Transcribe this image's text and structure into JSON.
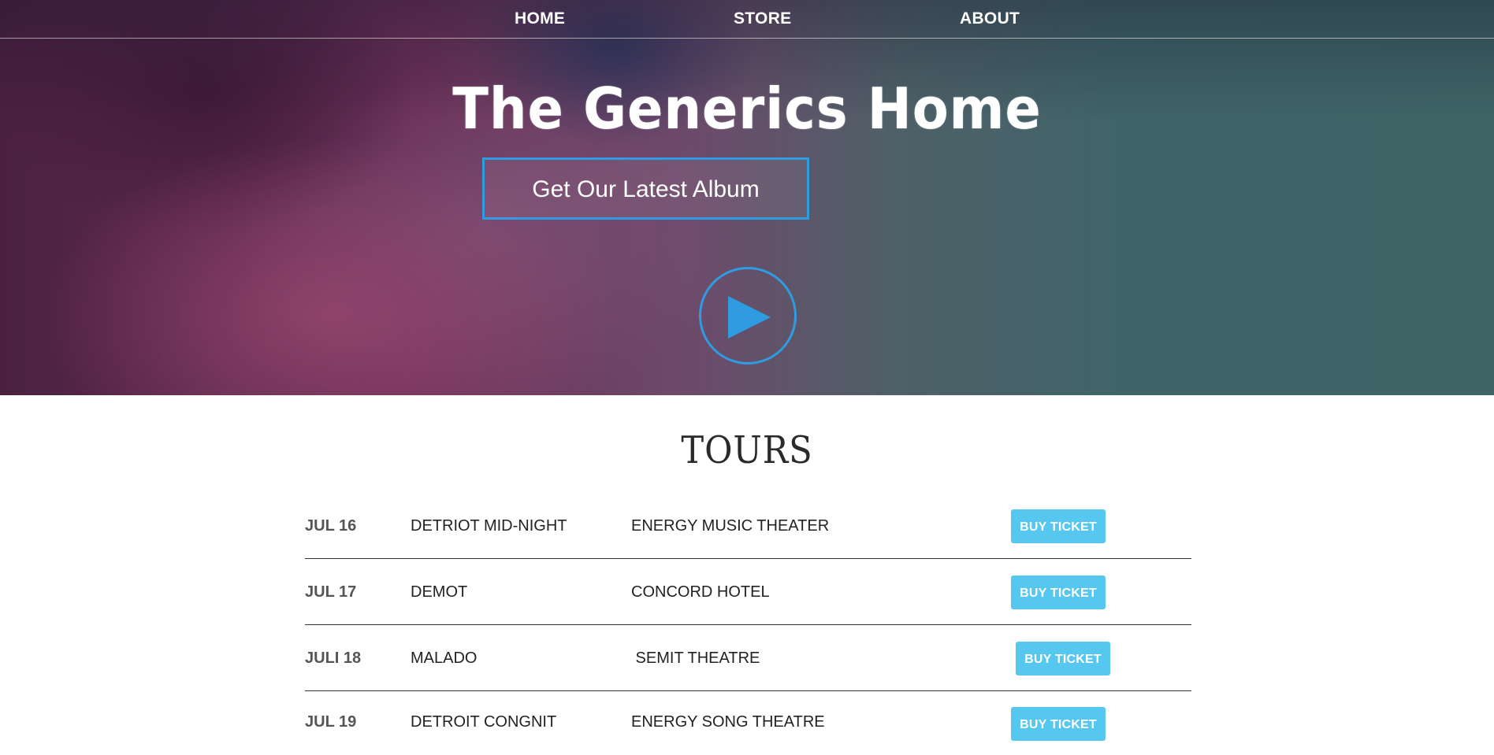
{
  "nav": {
    "items": [
      {
        "label": "HOME"
      },
      {
        "label": "STORE"
      },
      {
        "label": "ABOUT"
      }
    ]
  },
  "hero": {
    "title": "The Generics Home",
    "album_button": "Get Our Latest Album",
    "play_icon": "play-icon"
  },
  "tours": {
    "title": "TOURS",
    "rows": [
      {
        "date": "JUL 16",
        "city": "DETRIOT MID-NIGHT",
        "venue": "ENERGY MUSIC THEATER",
        "button": "BUY TICKET"
      },
      {
        "date": "JUL 17",
        "city": "DEMOT",
        "venue": "CONCORD HOTEL",
        "button": "BUY TICKET"
      },
      {
        "date": "JULI 18",
        "city": "MALADO",
        "venue": " SEMIT THEATRE",
        "button": "BUY TICKET"
      },
      {
        "date": "JUL 19",
        "city": "DETROIT CONGNIT",
        "venue": "ENERGY SONG THEATRE",
        "button": "BUY TICKET"
      }
    ]
  },
  "colors": {
    "accent_blue": "#2f9be0",
    "buy_button": "#56c8ef"
  }
}
